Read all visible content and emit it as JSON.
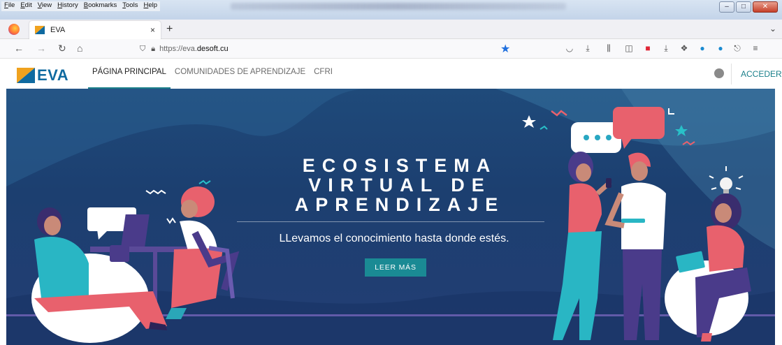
{
  "browser": {
    "menu": [
      "File",
      "Edit",
      "View",
      "History",
      "Bookmarks",
      "Tools",
      "Help"
    ],
    "tab_title": "EVA",
    "tab_close": "×",
    "new_tab": "+",
    "url_prefix": "https://eva.",
    "url_domain": "desoft.cu"
  },
  "site": {
    "logo_text": "EVA",
    "nav": [
      "PÁGINA PRINCIPAL",
      "COMUNIDADES DE APRENDIZAJE",
      "CFRI"
    ],
    "login": "ACCEDER"
  },
  "hero": {
    "headline_line1": "ECOSISTEMA",
    "headline_line2": "VIRTUAL DE",
    "headline_line3": "APRENDIZAJE",
    "tagline": "LLevamos el conocimiento hasta donde estés.",
    "cta": "LEER MÁS"
  },
  "colors": {
    "brand_blue": "#0f6aa0",
    "brand_orange": "#f0a21e",
    "accent_teal": "#1a8a94",
    "hero_bg": "#1f4a7a",
    "coral": "#e8616d"
  }
}
